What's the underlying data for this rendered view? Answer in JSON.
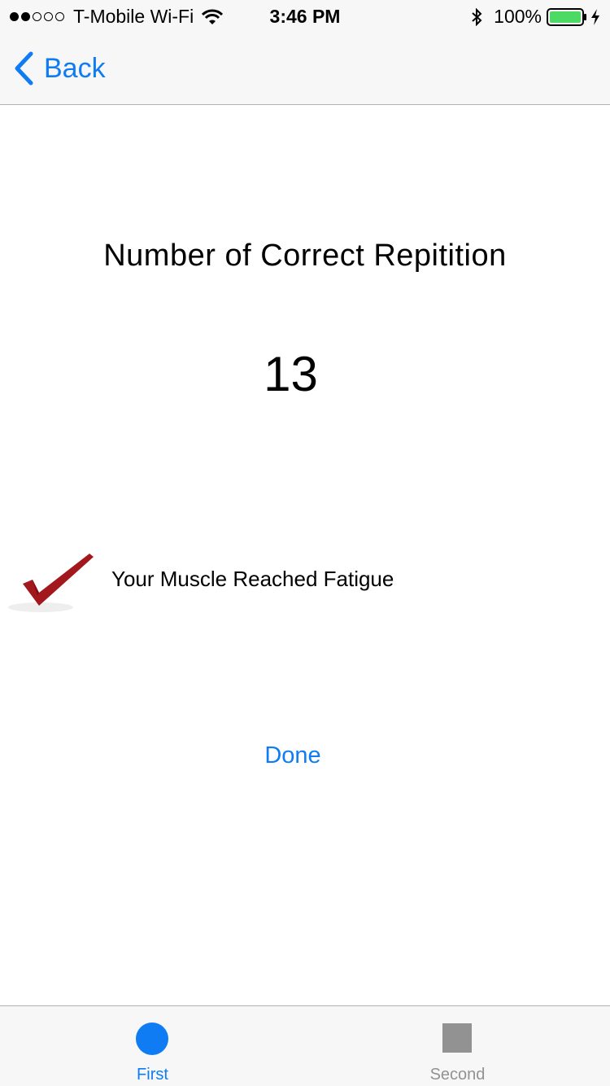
{
  "status_bar": {
    "signal_dots_filled": 2,
    "signal_dots_total": 5,
    "carrier": "T-Mobile Wi-Fi",
    "time": "3:46 PM",
    "battery_percent": "100%"
  },
  "nav": {
    "back_label": "Back"
  },
  "content": {
    "title": "Number of Correct Repitition",
    "count": "13",
    "status_message": "Your Muscle Reached Fatigue",
    "done_label": "Done"
  },
  "tab_bar": {
    "tabs": [
      {
        "label": "First",
        "icon": "circle-icon",
        "selected": true
      },
      {
        "label": "Second",
        "icon": "square-icon",
        "selected": false
      }
    ]
  },
  "colors": {
    "accent": "#0f7cf4",
    "inactive": "#929292",
    "battery": "#4cd964",
    "check": "#a3181c"
  }
}
